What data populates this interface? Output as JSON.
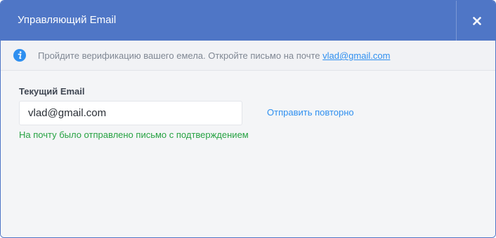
{
  "modal": {
    "title": "Управляющий Email",
    "close_icon": "close-icon"
  },
  "notice": {
    "icon": "info-icon",
    "text": "Пройдите верификацию вашего емела. Откройте письмо на почте ",
    "link_text": "vlad@gmail.com"
  },
  "form": {
    "label": "Текущий Email",
    "email_value": "vlad@gmail.com",
    "resend_label": "Отправить повторно",
    "success_message": "На почту было отправлено письмо с подтверждением"
  },
  "colors": {
    "header": "#4f76c6",
    "accent": "#2e8ff0",
    "success": "#27a243"
  }
}
